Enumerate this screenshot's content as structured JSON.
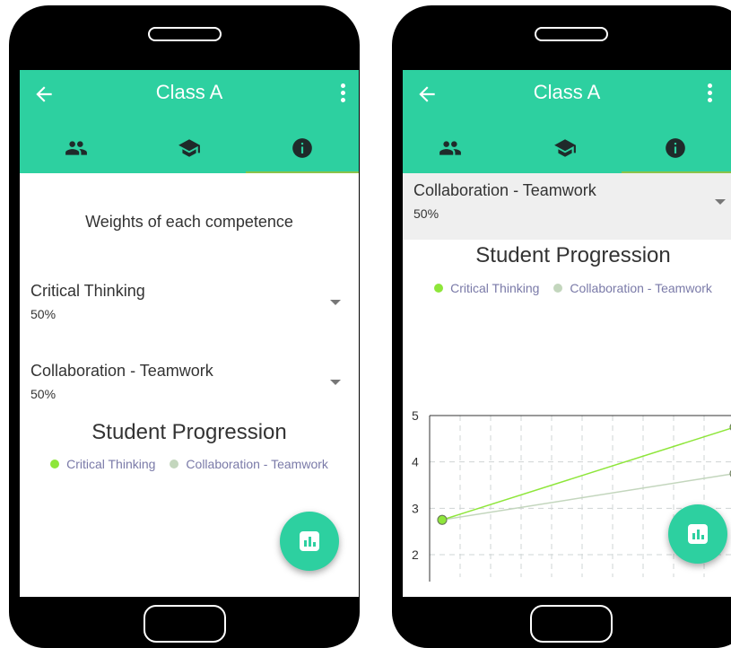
{
  "screens": [
    {
      "title": "Class A",
      "tabs": [
        {
          "icon": "people-icon"
        },
        {
          "icon": "school-icon"
        },
        {
          "icon": "info-icon"
        }
      ],
      "weights_title": "Weights of each competence",
      "competences": [
        {
          "label": "Critical Thinking",
          "value": "50%"
        },
        {
          "label": "Collaboration - Teamwork",
          "value": "50%"
        }
      ],
      "chart_title": "Student Progression",
      "legend": [
        "Critical Thinking",
        "Collaboration - Teamwork"
      ],
      "fab_icon": "bar-chart-icon"
    },
    {
      "title": "Class A",
      "tabs": [
        {
          "icon": "people-icon"
        },
        {
          "icon": "school-icon"
        },
        {
          "icon": "info-icon"
        }
      ],
      "selected_competence": {
        "label": "Collaboration - Teamwork",
        "value": "50%"
      },
      "chart_title": "Student Progression",
      "legend": [
        "Critical Thinking",
        "Collaboration - Teamwork"
      ],
      "fab_icon": "bar-chart-icon"
    }
  ],
  "colors": {
    "app_bar": "#2dd0a0",
    "tab_indicator": "#8bc34a",
    "critical_thinking": "#8ee63a",
    "collaboration": "#c3d6bd"
  },
  "chart_data": {
    "type": "line",
    "title": "Student Progression",
    "y_ticks": [
      "5",
      "4",
      "3",
      "2"
    ],
    "ylim": [
      2,
      5
    ],
    "grid": true,
    "legend_position": "top",
    "series": [
      {
        "name": "Critical Thinking",
        "x": [
          0,
          1
        ],
        "values": [
          2.75,
          4.75
        ]
      },
      {
        "name": "Collaboration - Teamwork",
        "x": [
          0,
          1
        ],
        "values": [
          2.75,
          3.75
        ]
      }
    ]
  }
}
